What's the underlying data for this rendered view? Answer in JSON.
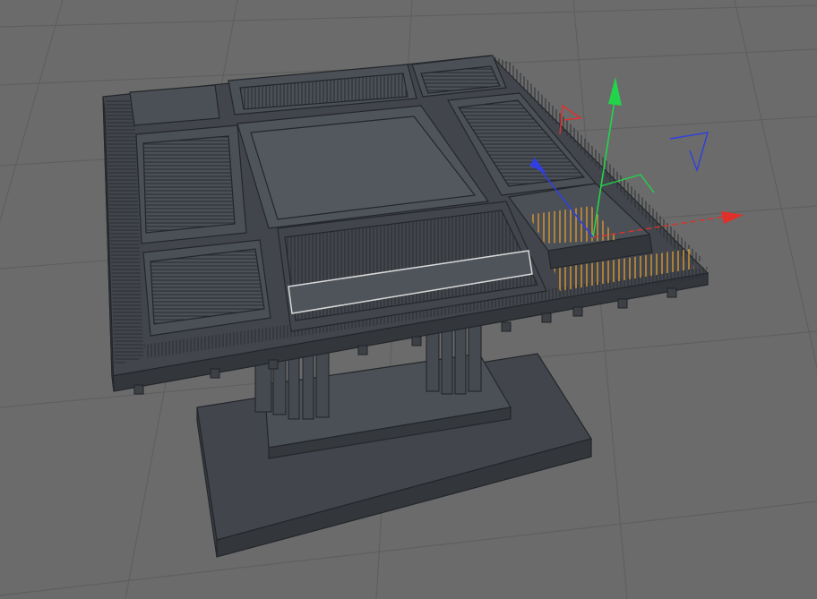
{
  "viewport": {
    "background": "#6b6b6b",
    "grid_color": "#5e5e5e",
    "model_fill": "#42464c",
    "model_fill_light": "#4f545b",
    "model_edge": "#23262a",
    "selection_color": "#d9d9d9",
    "highlight_color": "#e8a030"
  },
  "gizmo": {
    "x_color": "#e0302a",
    "y_color": "#22d44a",
    "z_color": "#2f3fe0",
    "axes": [
      "x-axis",
      "y-axis",
      "z-axis"
    ]
  }
}
